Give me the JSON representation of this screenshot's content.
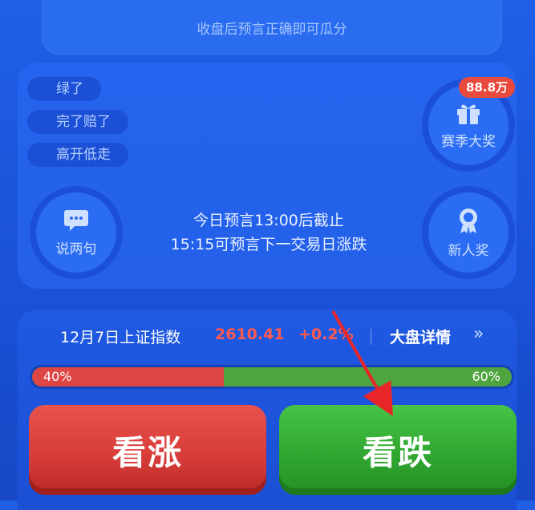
{
  "top": {
    "hint": "收盘后预言正确即可瓜分"
  },
  "tags": [
    "绿了",
    "完了赔了",
    "高开低走"
  ],
  "season_award": {
    "label": "赛季大奖",
    "badge": "88.8万"
  },
  "chat": {
    "label": "说两句"
  },
  "newcomer": {
    "label": "新人奖"
  },
  "notice": {
    "line1": "今日预言13:00后截止",
    "line2": "15:15可预言下一交易日涨跌"
  },
  "index": {
    "label": "12月7日上证指数",
    "value": "2610.41",
    "change": "+0.2%",
    "detail_link": "大盘详情",
    "chevron": "»"
  },
  "vote": {
    "up_pct_label": "40%",
    "down_pct_label": "60%",
    "up_fraction": 0.4
  },
  "buttons": {
    "up": "看涨",
    "down": "看跌"
  },
  "colors": {
    "up_red": "#dd4644",
    "down_green": "#4ea43e",
    "accent_bg": "#1f5fe6"
  }
}
